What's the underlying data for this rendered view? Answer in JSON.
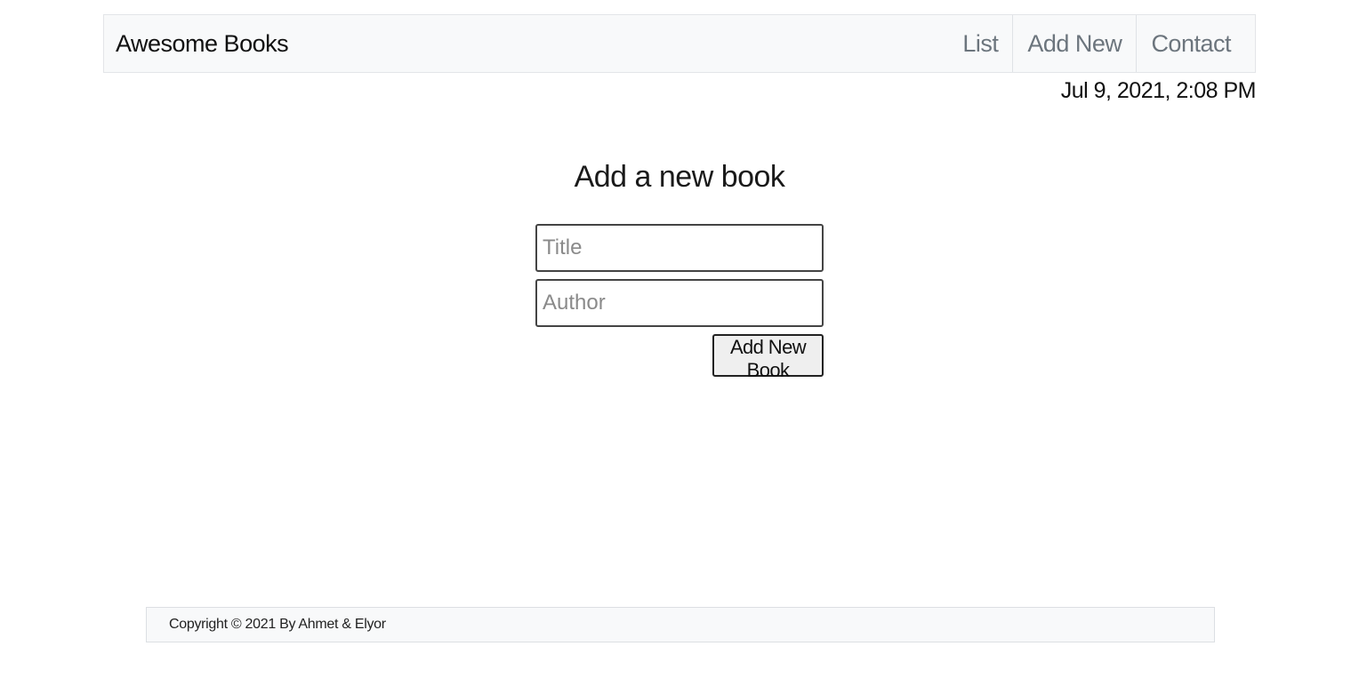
{
  "navbar": {
    "brand": "Awesome Books",
    "links": [
      {
        "label": "List"
      },
      {
        "label": "Add New"
      },
      {
        "label": "Contact"
      }
    ]
  },
  "datetime": "Jul 9, 2021, 2:08 PM",
  "form": {
    "heading": "Add a new book",
    "title_field": {
      "placeholder": "Title",
      "value": ""
    },
    "author_field": {
      "placeholder": "Author",
      "value": ""
    },
    "submit_label": "Add New Book"
  },
  "footer": {
    "copyright": "Copyright © 2021 By Ahmet & Elyor"
  },
  "colors": {
    "navbar_bg": "#f8f9fa",
    "nav_link": "#6c757d",
    "button_bg": "#efefef"
  }
}
